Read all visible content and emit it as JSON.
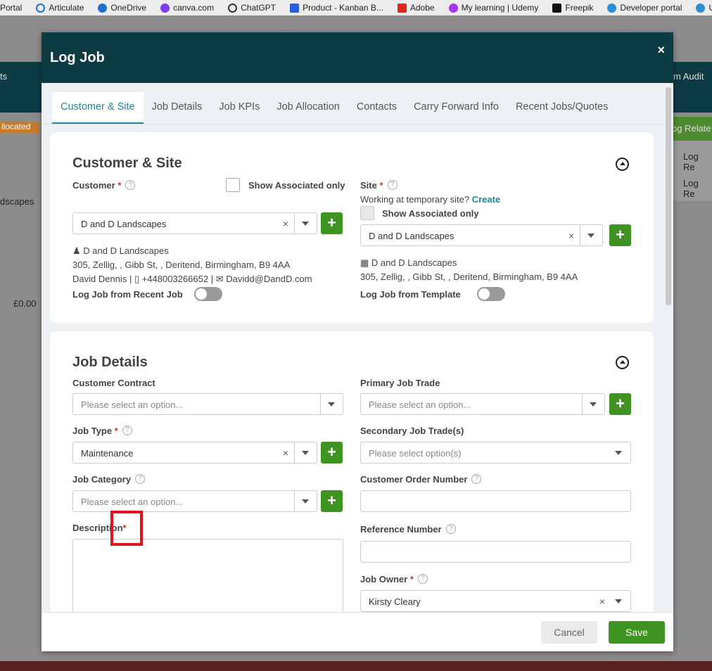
{
  "bookmarks": [
    "Portal",
    "Articulate",
    "OneDrive",
    "canva.com",
    "ChatGPT",
    "Product - Kanban B...",
    "Adobe",
    "My learning | Udemy",
    "Freepik",
    "Developer portal",
    "U"
  ],
  "background": {
    "nav_left": "ts",
    "nav_right": "m Audit",
    "allocated": "llocated",
    "landscapes": "dscapes",
    "amount": "£0.00",
    "log_related": "og Relate",
    "log_re1": "Log Re",
    "log_re2": "Log Re"
  },
  "modal": {
    "title": "Log Job",
    "close": "×",
    "tabs": [
      "Customer & Site",
      "Job Details",
      "Job KPIs",
      "Job Allocation",
      "Contacts",
      "Carry Forward Info",
      "Recent Jobs/Quotes"
    ]
  },
  "customer_site": {
    "heading": "Customer & Site",
    "customer_label": "Customer",
    "show_assoc": "Show Associated only",
    "customer_value": "D and D Landscapes",
    "customer_name": "D and D Landscapes",
    "customer_address": "305, Zellig, , Gibb St, , Deritend, Birmingham, B9 4AA",
    "contact_name": "David Dennis",
    "contact_phone": "+448003266652",
    "contact_email": "Davidd@DandD.com",
    "log_recent": "Log Job from Recent Job",
    "site_label": "Site",
    "temp_site": "Working at temporary site?",
    "create": "Create",
    "site_show_assoc": "Show Associated only",
    "site_value": "D and D Landscapes",
    "site_name": "D and D Landscapes",
    "site_address": "305, Zellig, , Gibb St, , Deritend, Birmingham, B9 4AA",
    "log_template": "Log Job from Template"
  },
  "job_details": {
    "heading": "Job Details",
    "customer_contract": "Customer Contract",
    "contract_ph": "Please select an option...",
    "primary_trade": "Primary Job Trade",
    "primary_ph": "Please select an option...",
    "job_type": "Job Type",
    "job_type_value": "Maintenance",
    "secondary_trade": "Secondary Job Trade(s)",
    "secondary_ph": "Please select option(s)",
    "job_category": "Job Category",
    "category_ph": "Please select an option...",
    "order_number": "Customer Order Number",
    "description": "Description",
    "reference": "Reference Number",
    "job_owner": "Job Owner",
    "owner_value": "Kirsty Cleary"
  },
  "footer": {
    "cancel": "Cancel",
    "save": "Save"
  }
}
